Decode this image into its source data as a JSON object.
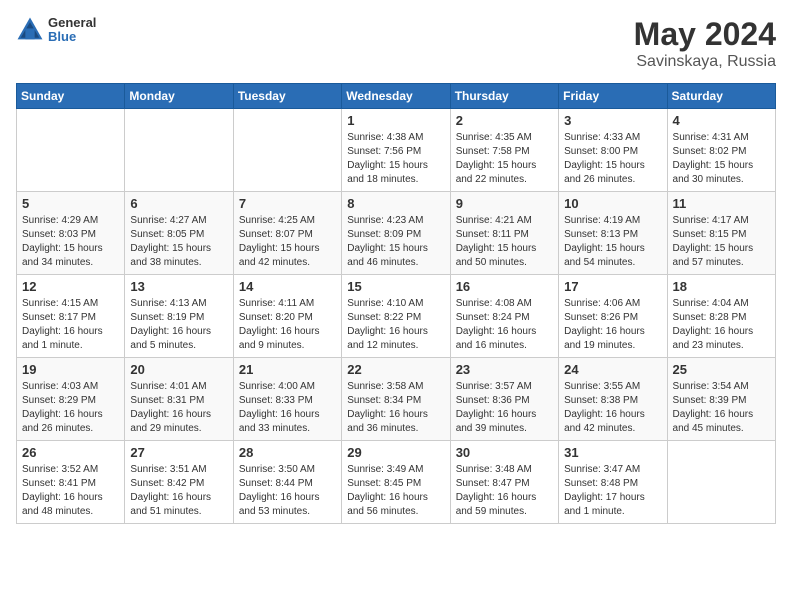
{
  "header": {
    "logo_general": "General",
    "logo_blue": "Blue",
    "title": "May 2024",
    "location": "Savinskaya, Russia"
  },
  "days_of_week": [
    "Sunday",
    "Monday",
    "Tuesday",
    "Wednesday",
    "Thursday",
    "Friday",
    "Saturday"
  ],
  "weeks": [
    [
      {
        "num": "",
        "info": ""
      },
      {
        "num": "",
        "info": ""
      },
      {
        "num": "",
        "info": ""
      },
      {
        "num": "1",
        "info": "Sunrise: 4:38 AM\nSunset: 7:56 PM\nDaylight: 15 hours\nand 18 minutes."
      },
      {
        "num": "2",
        "info": "Sunrise: 4:35 AM\nSunset: 7:58 PM\nDaylight: 15 hours\nand 22 minutes."
      },
      {
        "num": "3",
        "info": "Sunrise: 4:33 AM\nSunset: 8:00 PM\nDaylight: 15 hours\nand 26 minutes."
      },
      {
        "num": "4",
        "info": "Sunrise: 4:31 AM\nSunset: 8:02 PM\nDaylight: 15 hours\nand 30 minutes."
      }
    ],
    [
      {
        "num": "5",
        "info": "Sunrise: 4:29 AM\nSunset: 8:03 PM\nDaylight: 15 hours\nand 34 minutes."
      },
      {
        "num": "6",
        "info": "Sunrise: 4:27 AM\nSunset: 8:05 PM\nDaylight: 15 hours\nand 38 minutes."
      },
      {
        "num": "7",
        "info": "Sunrise: 4:25 AM\nSunset: 8:07 PM\nDaylight: 15 hours\nand 42 minutes."
      },
      {
        "num": "8",
        "info": "Sunrise: 4:23 AM\nSunset: 8:09 PM\nDaylight: 15 hours\nand 46 minutes."
      },
      {
        "num": "9",
        "info": "Sunrise: 4:21 AM\nSunset: 8:11 PM\nDaylight: 15 hours\nand 50 minutes."
      },
      {
        "num": "10",
        "info": "Sunrise: 4:19 AM\nSunset: 8:13 PM\nDaylight: 15 hours\nand 54 minutes."
      },
      {
        "num": "11",
        "info": "Sunrise: 4:17 AM\nSunset: 8:15 PM\nDaylight: 15 hours\nand 57 minutes."
      }
    ],
    [
      {
        "num": "12",
        "info": "Sunrise: 4:15 AM\nSunset: 8:17 PM\nDaylight: 16 hours\nand 1 minute."
      },
      {
        "num": "13",
        "info": "Sunrise: 4:13 AM\nSunset: 8:19 PM\nDaylight: 16 hours\nand 5 minutes."
      },
      {
        "num": "14",
        "info": "Sunrise: 4:11 AM\nSunset: 8:20 PM\nDaylight: 16 hours\nand 9 minutes."
      },
      {
        "num": "15",
        "info": "Sunrise: 4:10 AM\nSunset: 8:22 PM\nDaylight: 16 hours\nand 12 minutes."
      },
      {
        "num": "16",
        "info": "Sunrise: 4:08 AM\nSunset: 8:24 PM\nDaylight: 16 hours\nand 16 minutes."
      },
      {
        "num": "17",
        "info": "Sunrise: 4:06 AM\nSunset: 8:26 PM\nDaylight: 16 hours\nand 19 minutes."
      },
      {
        "num": "18",
        "info": "Sunrise: 4:04 AM\nSunset: 8:28 PM\nDaylight: 16 hours\nand 23 minutes."
      }
    ],
    [
      {
        "num": "19",
        "info": "Sunrise: 4:03 AM\nSunset: 8:29 PM\nDaylight: 16 hours\nand 26 minutes."
      },
      {
        "num": "20",
        "info": "Sunrise: 4:01 AM\nSunset: 8:31 PM\nDaylight: 16 hours\nand 29 minutes."
      },
      {
        "num": "21",
        "info": "Sunrise: 4:00 AM\nSunset: 8:33 PM\nDaylight: 16 hours\nand 33 minutes."
      },
      {
        "num": "22",
        "info": "Sunrise: 3:58 AM\nSunset: 8:34 PM\nDaylight: 16 hours\nand 36 minutes."
      },
      {
        "num": "23",
        "info": "Sunrise: 3:57 AM\nSunset: 8:36 PM\nDaylight: 16 hours\nand 39 minutes."
      },
      {
        "num": "24",
        "info": "Sunrise: 3:55 AM\nSunset: 8:38 PM\nDaylight: 16 hours\nand 42 minutes."
      },
      {
        "num": "25",
        "info": "Sunrise: 3:54 AM\nSunset: 8:39 PM\nDaylight: 16 hours\nand 45 minutes."
      }
    ],
    [
      {
        "num": "26",
        "info": "Sunrise: 3:52 AM\nSunset: 8:41 PM\nDaylight: 16 hours\nand 48 minutes."
      },
      {
        "num": "27",
        "info": "Sunrise: 3:51 AM\nSunset: 8:42 PM\nDaylight: 16 hours\nand 51 minutes."
      },
      {
        "num": "28",
        "info": "Sunrise: 3:50 AM\nSunset: 8:44 PM\nDaylight: 16 hours\nand 53 minutes."
      },
      {
        "num": "29",
        "info": "Sunrise: 3:49 AM\nSunset: 8:45 PM\nDaylight: 16 hours\nand 56 minutes."
      },
      {
        "num": "30",
        "info": "Sunrise: 3:48 AM\nSunset: 8:47 PM\nDaylight: 16 hours\nand 59 minutes."
      },
      {
        "num": "31",
        "info": "Sunrise: 3:47 AM\nSunset: 8:48 PM\nDaylight: 17 hours\nand 1 minute."
      },
      {
        "num": "",
        "info": ""
      }
    ]
  ]
}
